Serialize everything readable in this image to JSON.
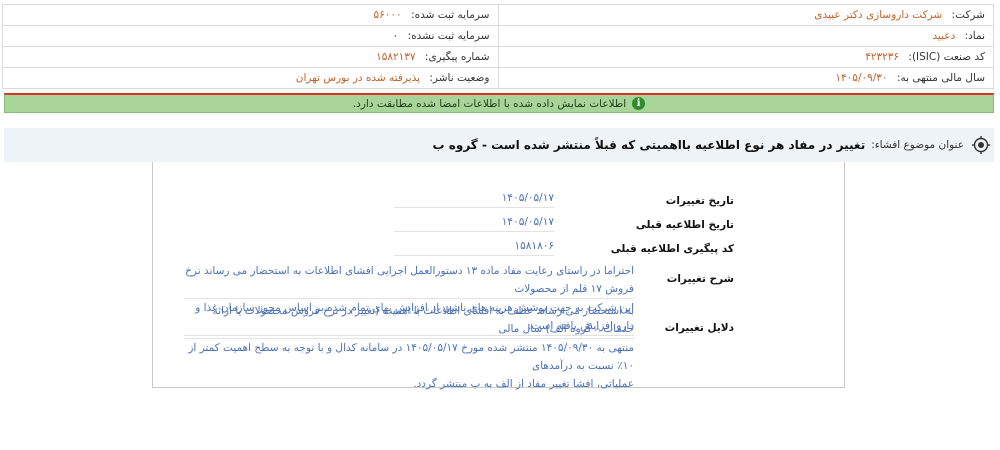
{
  "company_info": {
    "company_label": "شرکت:",
    "company_value": "شرکت داروسازی دکتر عبیدی",
    "registered_capital_label": "سرمایه ثبت شده:",
    "registered_capital_value": "۵۶۰۰۰",
    "symbol_label": "نماد:",
    "symbol_value": "دعبید",
    "unregistered_capital_label": "سرمایه ثبت نشده:",
    "unregistered_capital_value": "۰",
    "isic_label": "کد صنعت (ISIC):",
    "isic_value": "۴۲۳۲۳۶",
    "tracking_label": "شماره پیگیری:",
    "tracking_value": "۱۵۸۲۱۳۷",
    "fiscal_year_label": "سال مالی منتهی به:",
    "fiscal_year_value": "۱۴۰۵/۰۹/۳۰",
    "status_label": "وضعیت ناشر:",
    "status_value": "پذیرفته شده در بورس تهران"
  },
  "notice": {
    "text": "اطلاعات نمایش داده شده با اطلاعات امضا شده مطابقت دارد.",
    "icon": "info-icon"
  },
  "subject": {
    "label": "عنوان موضوع افشاء:",
    "text": "تغییر در مفاد هر نوع اطلاعیه بااهمیتی که قبلاً منتشر شده است - گروه ب"
  },
  "details": {
    "change_date_label": "تاریخ تغییرات",
    "change_date_value": "۱۴۰۵/۰۵/۱۷",
    "prev_notice_date_label": "تاریخ اطلاعیه قبلی",
    "prev_notice_date_value": "۱۴۰۵/۰۵/۱۷",
    "prev_tracking_label": "کد پیگیری اطلاعیه قبلی",
    "prev_tracking_value": "۱۵۸۱۸۰۶",
    "description_label": "شرح تغییرات",
    "description_line1": "احتراما در راستای رعایت مفاد ماده ۱۳ دستورالعمل اجرایی افشای اطلاعات به استحضار می رساند نرخ فروش ۱۷ قلم از محصولات",
    "description_line2": "این شرکت به جهت پوشش هزینه های ناشی از افزایش بهای تمام شده بر اساس مجوز سازمان غذا و دارو افزایش یافته است.",
    "reasons_label": "دلایل تغییرات",
    "reasons_line1": "به استحضار می رساند عطف به افشای اطلاعات با اهمیت (تغییر در نرخ فروش محصولات یا ارائه خدمات – گروه الف) سال مالی",
    "reasons_line2": "منتهی به ۱۴۰۵/۰۹/۳۰ منتشر شده مورخ ۱۴۰۵/۰۵/۱۷ در سامانه کدال و با توجه به سطح اهمیت کمتر از ۱۰٪ نسبت به درآمدهای",
    "reasons_line3": "عملیاتی، افشا تغییر مفاد از الف به ب منتشر گردد."
  }
}
